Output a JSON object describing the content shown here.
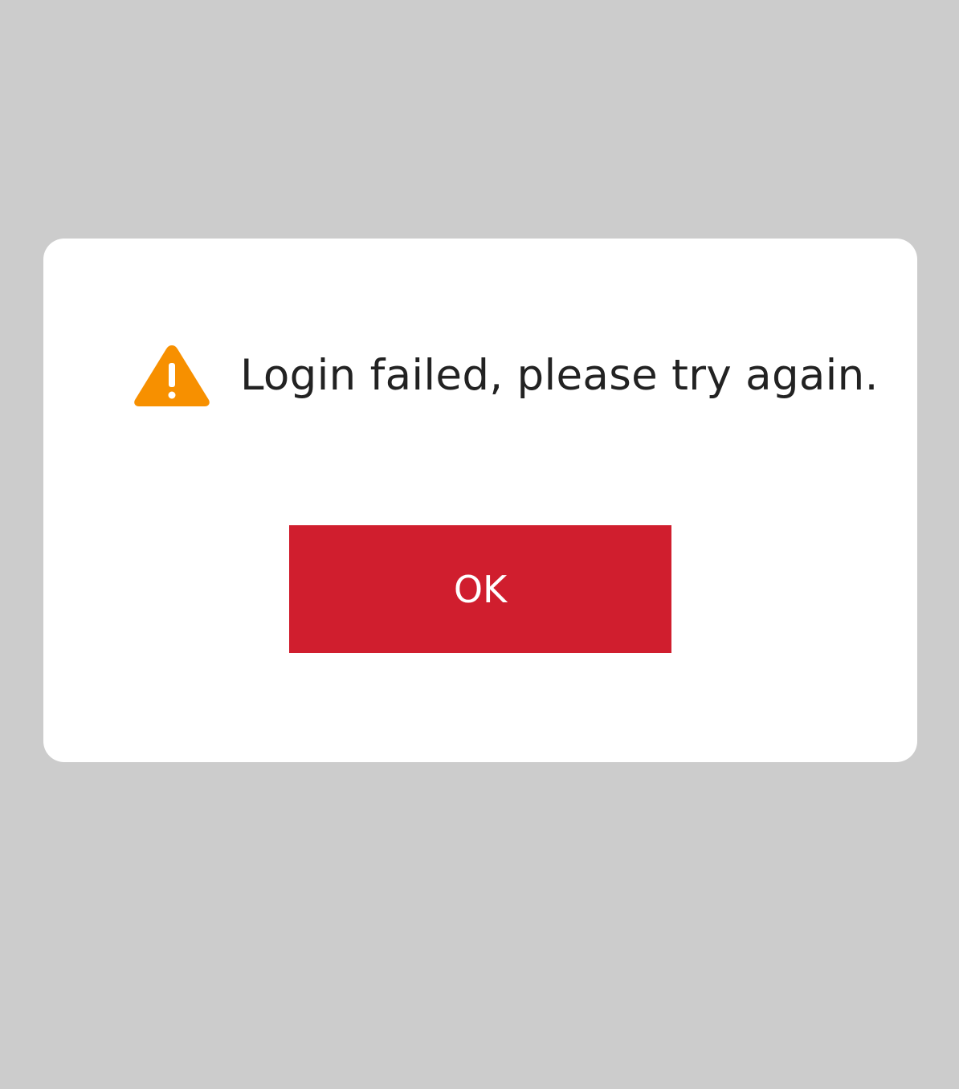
{
  "dialog": {
    "icon": "warning-icon",
    "message": "Login failed, please try again.",
    "ok_label": "OK"
  },
  "colors": {
    "backdrop": "#cccccc",
    "dialog_bg": "#ffffff",
    "warning": "#f79000",
    "button_bg": "#d01e2e",
    "button_text": "#ffffff",
    "message_text": "#222222"
  }
}
